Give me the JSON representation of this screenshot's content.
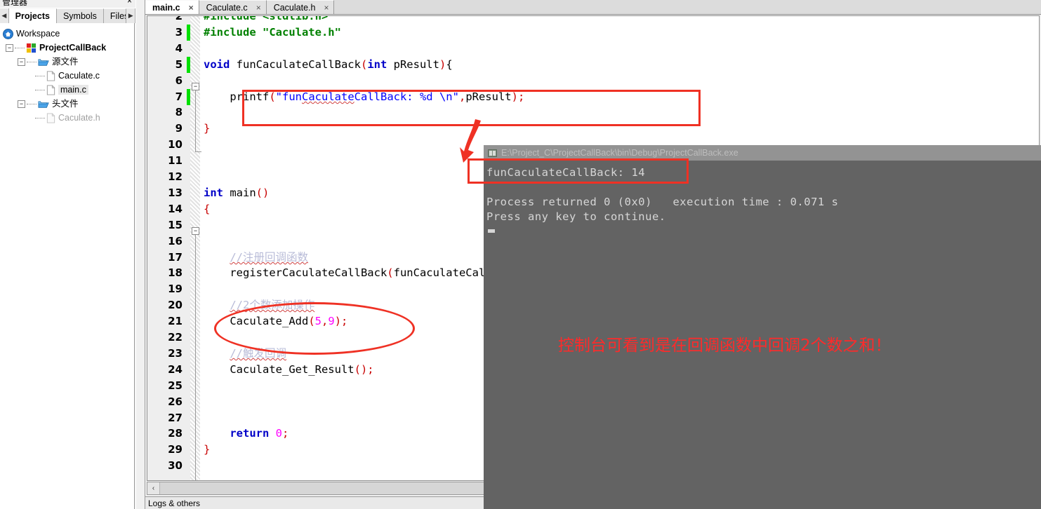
{
  "left_panel": {
    "title": "管理器",
    "close_label": "×",
    "prev_arrow": "◀",
    "next_arrow": "▶",
    "tabs": [
      {
        "label": "Projects",
        "active": true
      },
      {
        "label": "Symbols",
        "active": false
      },
      {
        "label": "Files",
        "active": false
      }
    ],
    "tree": [
      {
        "label": "Workspace",
        "depth": 0,
        "icon": "workspace-icon",
        "expander": "",
        "style": ""
      },
      {
        "label": "ProjectCallBack",
        "depth": 1,
        "icon": "project-icon",
        "expander": "-",
        "style": "bold"
      },
      {
        "label": "源文件",
        "depth": 2,
        "icon": "folder-icon",
        "expander": "-",
        "style": ""
      },
      {
        "label": "Caculate.c",
        "depth": 3,
        "icon": "file-icon",
        "expander": "",
        "style": ""
      },
      {
        "label": "main.c",
        "depth": 3,
        "icon": "file-icon",
        "expander": "",
        "style": "sel"
      },
      {
        "label": "头文件",
        "depth": 2,
        "icon": "folder-icon",
        "expander": "-",
        "style": ""
      },
      {
        "label": "Caculate.h",
        "depth": 3,
        "icon": "file-icon",
        "expander": "",
        "style": "gray"
      }
    ]
  },
  "editor": {
    "tabs": [
      {
        "label": "main.c",
        "close": "×",
        "active": true
      },
      {
        "label": "Caculate.c",
        "close": "×",
        "active": false
      },
      {
        "label": "Caculate.h",
        "close": "×",
        "active": false
      }
    ],
    "first_line_number": 2,
    "lines": [
      {
        "n": 2,
        "changed": false,
        "text": "#include <stdlib.h>"
      },
      {
        "n": 3,
        "changed": true,
        "text": "#include \"Caculate.h\""
      },
      {
        "n": 4,
        "changed": false,
        "text": ""
      },
      {
        "n": 5,
        "changed": true,
        "text": "void funCaculateCallBack(int pResult){"
      },
      {
        "n": 6,
        "changed": false,
        "text": ""
      },
      {
        "n": 7,
        "changed": true,
        "text": "    printf(\"funCaculateCallBack: %d \\n\",pResult);"
      },
      {
        "n": 8,
        "changed": false,
        "text": ""
      },
      {
        "n": 9,
        "changed": false,
        "text": "}"
      },
      {
        "n": 10,
        "changed": false,
        "text": ""
      },
      {
        "n": 11,
        "changed": false,
        "text": ""
      },
      {
        "n": 12,
        "changed": false,
        "text": ""
      },
      {
        "n": 13,
        "changed": false,
        "text": "int main()"
      },
      {
        "n": 14,
        "changed": false,
        "text": "{"
      },
      {
        "n": 15,
        "changed": false,
        "text": ""
      },
      {
        "n": 16,
        "changed": false,
        "text": ""
      },
      {
        "n": 17,
        "changed": false,
        "text": "    //注册回调函数"
      },
      {
        "n": 18,
        "changed": false,
        "text": "    registerCaculateCallBack(funCaculateCallBack);"
      },
      {
        "n": 19,
        "changed": false,
        "text": ""
      },
      {
        "n": 20,
        "changed": false,
        "text": "    //2个数添加操作"
      },
      {
        "n": 21,
        "changed": false,
        "text": "    Caculate_Add(5,9);"
      },
      {
        "n": 22,
        "changed": false,
        "text": ""
      },
      {
        "n": 23,
        "changed": false,
        "text": "    //触发回调"
      },
      {
        "n": 24,
        "changed": false,
        "text": "    Caculate_Get_Result();"
      },
      {
        "n": 25,
        "changed": false,
        "text": ""
      },
      {
        "n": 26,
        "changed": false,
        "text": ""
      },
      {
        "n": 27,
        "changed": false,
        "text": ""
      },
      {
        "n": 28,
        "changed": false,
        "text": "    return 0;"
      },
      {
        "n": 29,
        "changed": false,
        "text": "}"
      },
      {
        "n": 30,
        "changed": false,
        "text": ""
      }
    ],
    "hscroll_left_arrow": "‹",
    "bottom_panel_label": "Logs & others"
  },
  "console": {
    "title": "E:\\Project_C\\ProjectCallBack\\bin\\Debug\\ProjectCallBack.exe",
    "output_line_1": "funCaculateCallBack: 14",
    "output_line_2": "Process returned 0 (0x0)   execution time : 0.071 s",
    "output_line_3": "Press any key to continue."
  },
  "annotations": {
    "note_text": "控制台可看到是在回调函数中回调2个数之和！",
    "color": "#ff2a2a"
  },
  "colors": {
    "annotation_red": "#ef3124",
    "keyword_blue": "#0000c8",
    "preprocessor_green": "#008000",
    "string_blue": "#0000ff",
    "number_magenta": "#ff00ff",
    "punct_red": "#c80000",
    "comment_lavender": "#b9bcd8",
    "console_bg": "#636363",
    "console_titlebar": "#939393",
    "change_marker_green": "#00e000"
  }
}
